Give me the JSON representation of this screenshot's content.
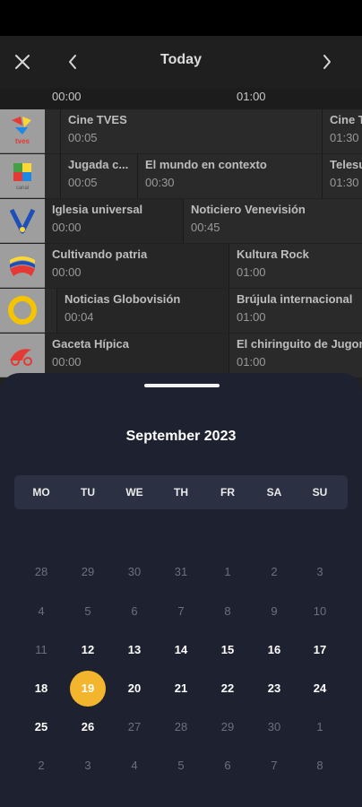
{
  "header": {
    "title": "Today"
  },
  "timeline": [
    "00:00",
    "01:00"
  ],
  "channels": [
    {
      "name": "tves-logo",
      "programs": [
        {
          "title": "Cine TVES",
          "time": "00:05"
        },
        {
          "title": "Cine TVES",
          "time": "01:30"
        }
      ]
    },
    {
      "name": "canal-logo",
      "programs": [
        {
          "title": "Jugada c...",
          "time": "00:05"
        },
        {
          "title": "El mundo en contexto",
          "time": "00:30"
        },
        {
          "title": "Telesur",
          "time": "01:30"
        }
      ]
    },
    {
      "name": "venevision-logo",
      "programs": [
        {
          "title": "Iglesia universal",
          "time": "00:00"
        },
        {
          "title": "Noticiero Venevisión",
          "time": "00:45"
        }
      ]
    },
    {
      "name": "vtv-logo",
      "programs": [
        {
          "title": "Cultivando patria",
          "time": "00:00"
        },
        {
          "title": "Kultura Rock",
          "time": "01:00"
        }
      ]
    },
    {
      "name": "globovision-logo",
      "programs": [
        {
          "title": "Noticias Globovisión",
          "time": "00:04"
        },
        {
          "title": "Brújula internacional",
          "time": "01:00"
        }
      ]
    },
    {
      "name": "meridiano-logo",
      "programs": [
        {
          "title": "Gaceta Hípica",
          "time": "00:00"
        },
        {
          "title": "El chiringuito de Jugones",
          "time": "01:00"
        }
      ]
    }
  ],
  "calendar": {
    "title": "September  2023",
    "weekdays": [
      "MO",
      "TU",
      "WE",
      "TH",
      "FR",
      "SA",
      "SU"
    ],
    "weeks": [
      [
        "28",
        "29",
        "30",
        "31",
        "1",
        "2",
        "3"
      ],
      [
        "4",
        "5",
        "6",
        "7",
        "8",
        "9",
        "10"
      ],
      [
        "11",
        "12",
        "13",
        "14",
        "15",
        "16",
        "17"
      ],
      [
        "18",
        "19",
        "20",
        "21",
        "22",
        "23",
        "24"
      ],
      [
        "25",
        "26",
        "27",
        "28",
        "29",
        "30",
        "1"
      ],
      [
        "2",
        "3",
        "4",
        "5",
        "6",
        "7",
        "8"
      ]
    ],
    "available_dates": [
      "12",
      "13",
      "14",
      "15",
      "16",
      "17",
      "18",
      "19",
      "20",
      "21",
      "22",
      "23",
      "24",
      "25",
      "26"
    ],
    "selected_date": "19",
    "colors": {
      "sheet": "#1e2130",
      "weekday_bar": "#2b3042",
      "selected": "#f3b52d",
      "muted": "#6b6f7e"
    }
  }
}
